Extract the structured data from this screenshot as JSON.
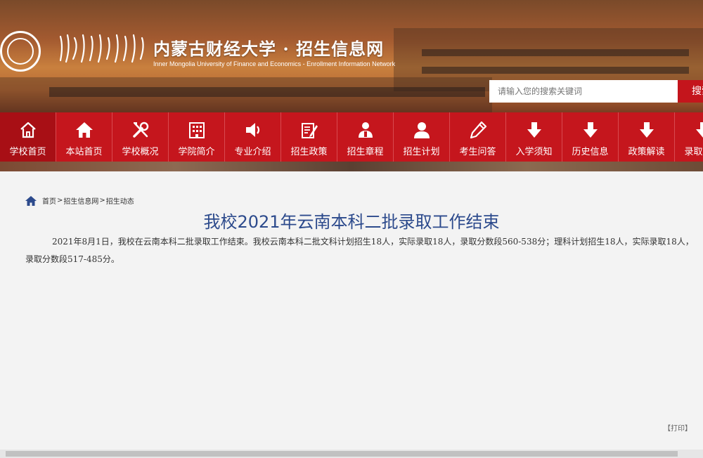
{
  "header": {
    "logo_title": "内蒙古财经大学 · 招生信息网",
    "logo_subtitle": "Inner Mongolia University of Finance and Economics - Enrollment Information Network",
    "search_placeholder": "请输入您的搜索关键词",
    "search_button_label": "搜索"
  },
  "nav": {
    "items": [
      {
        "label": "学校首页",
        "icon": "home-outline-icon"
      },
      {
        "label": "本站首页",
        "icon": "home-icon"
      },
      {
        "label": "学校概况",
        "icon": "tools-icon"
      },
      {
        "label": "学院简介",
        "icon": "building-icon"
      },
      {
        "label": "专业介绍",
        "icon": "speaker-icon"
      },
      {
        "label": "招生政策",
        "icon": "edit-icon"
      },
      {
        "label": "招生章程",
        "icon": "users-icon"
      },
      {
        "label": "招生计划",
        "icon": "user-icon"
      },
      {
        "label": "考生问答",
        "icon": "pen-icon"
      },
      {
        "label": "入学须知",
        "icon": "download-arrow-icon"
      },
      {
        "label": "历史信息",
        "icon": "download-arrow-icon"
      },
      {
        "label": "政策解读",
        "icon": "download-arrow-icon"
      },
      {
        "label": "录取查询",
        "icon": "download-arrow-icon"
      }
    ],
    "active_index": 0
  },
  "breadcrumb": {
    "items": [
      "首页",
      "招生信息网",
      "招生动态"
    ],
    "separator": ">"
  },
  "article": {
    "title": "我校2021年云南本科二批录取工作结束",
    "body": "2021年8月1日，我校在云南本科二批录取工作结束。我校云南本科二批文科计划招生18人，实际录取18人，录取分数段560-538分；理科计划招生18人，实际录取18人，录取分数段517-485分。",
    "print_label": "【打印】"
  },
  "colors": {
    "nav_red": "#c5161d",
    "title_blue": "#2c4a8c"
  }
}
